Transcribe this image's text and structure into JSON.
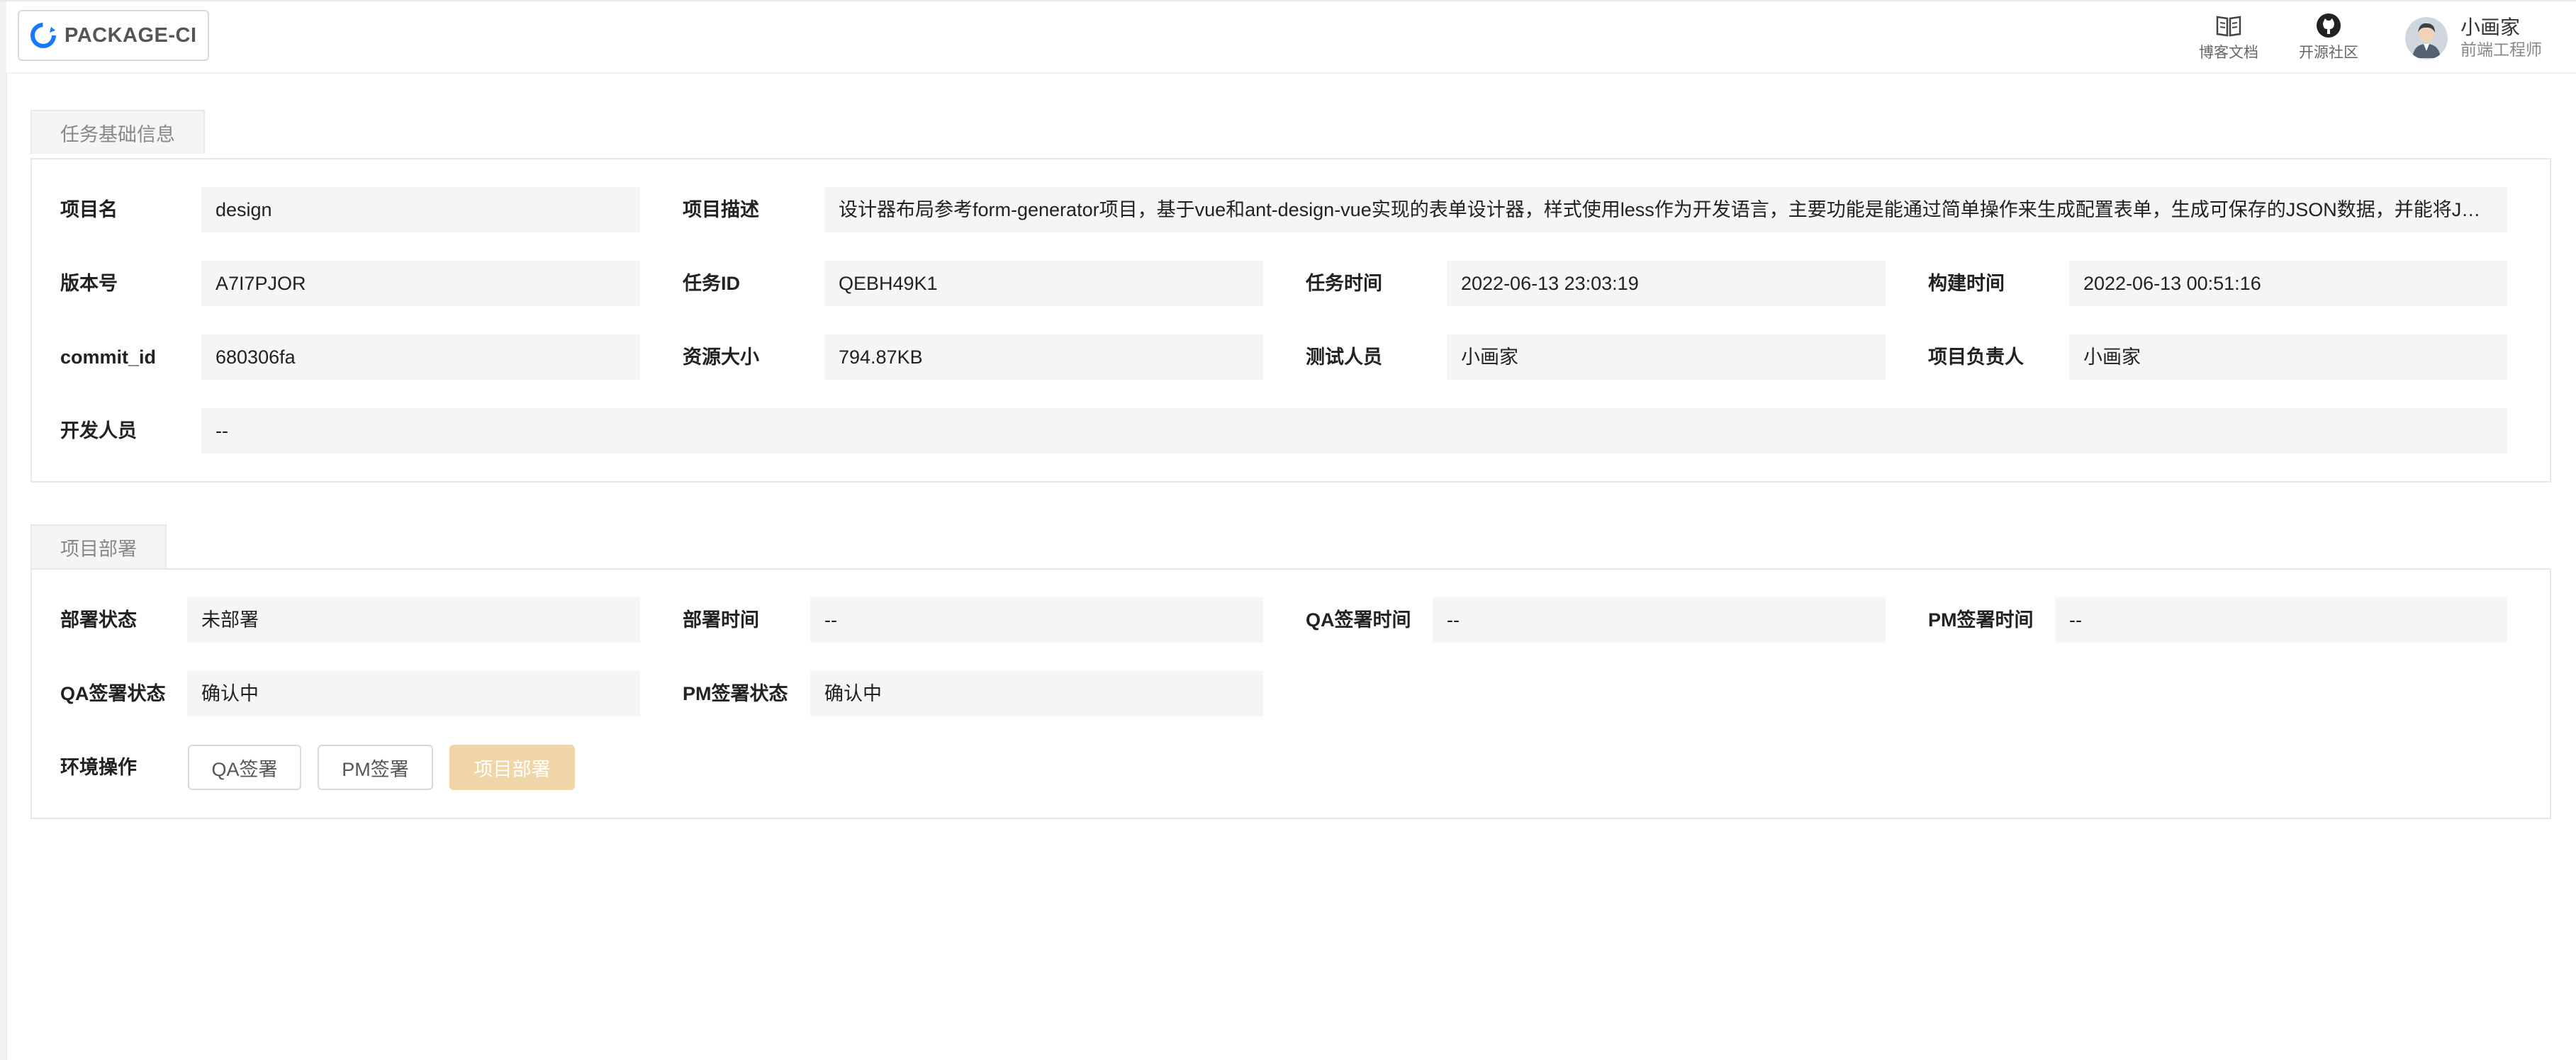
{
  "header": {
    "logo_text": "PACKAGE-CI",
    "links": [
      {
        "label": "博客文档",
        "icon": "book-icon"
      },
      {
        "label": "开源社区",
        "icon": "github-icon"
      }
    ],
    "user": {
      "name": "小画家",
      "role": "前端工程师"
    }
  },
  "task_info": {
    "tab": "任务基础信息",
    "project_name": {
      "label": "项目名",
      "value": "design"
    },
    "project_desc": {
      "label": "项目描述",
      "value": "设计器布局参考form-generator项目，基于vue和ant-design-vue实现的表单设计器，样式使用less作为开发语言，主要功能是能通过简单操作来生成配置表单，生成可保存的JSON数据，并能将JSON还原成表单，使表单开发更简单更快速"
    },
    "version": {
      "label": "版本号",
      "value": "A7I7PJOR"
    },
    "task_id": {
      "label": "任务ID",
      "value": "QEBH49K1"
    },
    "task_time": {
      "label": "任务时间",
      "value": "2022-06-13 23:03:19"
    },
    "build_time": {
      "label": "构建时间",
      "value": "2022-06-13 00:51:16"
    },
    "commit_id": {
      "label": "commit_id",
      "value": "680306fa"
    },
    "resource_size": {
      "label": "资源大小",
      "value": "794.87KB"
    },
    "tester": {
      "label": "测试人员",
      "value": "小画家"
    },
    "owner": {
      "label": "项目负责人",
      "value": "小画家"
    },
    "developer": {
      "label": "开发人员",
      "value": "--"
    }
  },
  "deploy": {
    "tab": "项目部署",
    "status": {
      "label": "部署状态",
      "value": "未部署"
    },
    "deploy_time": {
      "label": "部署时间",
      "value": "--"
    },
    "qa_sign_time": {
      "label": "QA签署时间",
      "value": "--"
    },
    "pm_sign_time": {
      "label": "PM签署时间",
      "value": "--"
    },
    "qa_sign_status": {
      "label": "QA签署状态",
      "value": "确认中"
    },
    "pm_sign_status": {
      "label": "PM签署状态",
      "value": "确认中"
    },
    "env_ops": {
      "label": "环境操作",
      "buttons": {
        "qa_sign": "QA签署",
        "pm_sign": "PM签署",
        "deploy": "项目部署"
      }
    }
  },
  "colors": {
    "accent_disabled": "#f0d6a6",
    "logo_blue": "#1677ff"
  }
}
